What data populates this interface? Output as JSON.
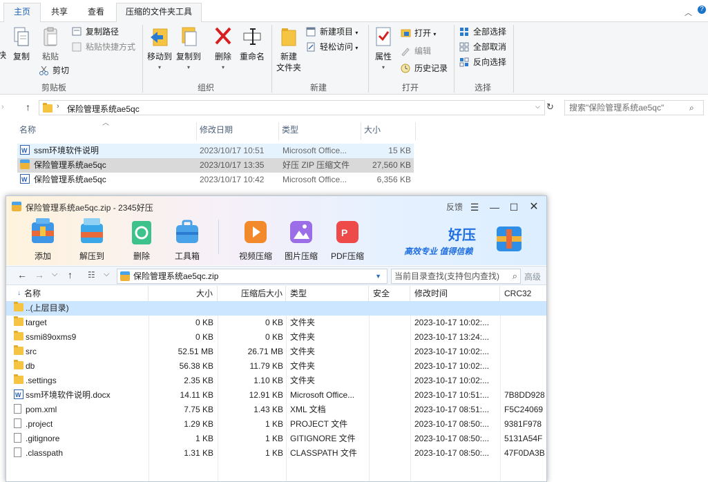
{
  "explorer": {
    "tabs": [
      "主页",
      "共享",
      "查看",
      "压缩的文件夹工具"
    ],
    "ribbon": {
      "clipboard": {
        "label": "剪贴板",
        "cut_partial": "快",
        "copy": "复制",
        "paste": "粘贴",
        "copy_path": "复制路径",
        "paste_shortcut": "粘贴快捷方式",
        "cut": "剪切"
      },
      "organize": {
        "label": "组织",
        "move_to": "移动到",
        "copy_to": "复制到",
        "delete": "删除",
        "rename": "重命名"
      },
      "new": {
        "label": "新建",
        "new_folder_l1": "新建",
        "new_folder_l2": "文件夹",
        "new_item": "新建项目",
        "easy_access": "轻松访问"
      },
      "open": {
        "label": "打开",
        "properties": "属性",
        "open": "打开",
        "edit": "编辑",
        "history": "历史记录"
      },
      "select": {
        "label": "选择",
        "select_all": "全部选择",
        "select_none": "全部取消",
        "invert": "反向选择"
      }
    },
    "address": {
      "path": "保险管理系统ae5qc",
      "search_placeholder": "搜索\"保险管理系统ae5qc\""
    },
    "columns": [
      "名称",
      "修改日期",
      "类型",
      "大小"
    ],
    "files": [
      {
        "name": "ssm环境软件说明",
        "date": "2023/10/17 10:51",
        "type": "Microsoft Office...",
        "size": "15 KB",
        "icon": "word-doc-icon"
      },
      {
        "name": "保险管理系统ae5qc",
        "date": "2023/10/17 13:35",
        "type": "好压 ZIP 压缩文件",
        "size": "27,560 KB",
        "icon": "zip-archive-icon"
      },
      {
        "name": "保险管理系统ae5qc",
        "date": "2023/10/17 10:42",
        "type": "Microsoft Office...",
        "size": "6,356 KB",
        "icon": "word-doc-icon"
      }
    ]
  },
  "haozip": {
    "title": "保险管理系统ae5qc.zip - 2345好压",
    "feedback": "反馈",
    "toolbar": [
      {
        "label": "添加",
        "icon": "add-archive-icon"
      },
      {
        "label": "解压到",
        "icon": "extract-icon"
      },
      {
        "label": "删除",
        "icon": "recycle-delete-icon"
      },
      {
        "label": "工具箱",
        "icon": "toolbox-icon"
      },
      {
        "label": "视频压缩",
        "icon": "video-compress-icon"
      },
      {
        "label": "图片压缩",
        "icon": "image-compress-icon"
      },
      {
        "label": "PDF压缩",
        "icon": "pdf-compress-icon"
      }
    ],
    "brand": {
      "name": "好压",
      "slogan": "高效专业 值得信赖"
    },
    "path": "保险管理系统ae5qc.zip",
    "search_placeholder": "当前目录查找(支持包内查找)",
    "advanced": "高级",
    "columns": [
      "名称",
      "大小",
      "压缩后大小",
      "类型",
      "安全",
      "修改时间",
      "CRC32"
    ],
    "rows": [
      {
        "name": "..(上层目录)",
        "size": "",
        "packed": "",
        "type": "",
        "security": "",
        "modified": "",
        "crc": "",
        "icon": "folder-icon"
      },
      {
        "name": "target",
        "size": "0 KB",
        "packed": "0 KB",
        "type": "文件夹",
        "security": "",
        "modified": "2023-10-17 10:02:...",
        "crc": "",
        "icon": "folder-icon"
      },
      {
        "name": "ssmi89oxms9",
        "size": "0 KB",
        "packed": "0 KB",
        "type": "文件夹",
        "security": "",
        "modified": "2023-10-17 13:24:...",
        "crc": "",
        "icon": "folder-icon"
      },
      {
        "name": "src",
        "size": "52.51 MB",
        "packed": "26.71 MB",
        "type": "文件夹",
        "security": "",
        "modified": "2023-10-17 10:02:...",
        "crc": "",
        "icon": "folder-icon"
      },
      {
        "name": "db",
        "size": "56.38 KB",
        "packed": "11.79 KB",
        "type": "文件夹",
        "security": "",
        "modified": "2023-10-17 10:02:...",
        "crc": "",
        "icon": "folder-icon"
      },
      {
        "name": ".settings",
        "size": "2.35 KB",
        "packed": "1.10 KB",
        "type": "文件夹",
        "security": "",
        "modified": "2023-10-17 10:02:...",
        "crc": "",
        "icon": "folder-icon"
      },
      {
        "name": "ssm环境软件说明.docx",
        "size": "14.11 KB",
        "packed": "12.91 KB",
        "type": "Microsoft Office...",
        "security": "",
        "modified": "2023-10-17 10:51:...",
        "crc": "7B8DD928",
        "icon": "word-doc-icon"
      },
      {
        "name": "pom.xml",
        "size": "7.75 KB",
        "packed": "1.43 KB",
        "type": "XML 文档",
        "security": "",
        "modified": "2023-10-17 08:51:...",
        "crc": "F5C24069",
        "icon": "file-icon"
      },
      {
        "name": ".project",
        "size": "1.29 KB",
        "packed": "1 KB",
        "type": "PROJECT 文件",
        "security": "",
        "modified": "2023-10-17 08:50:...",
        "crc": "9381F978",
        "icon": "file-icon"
      },
      {
        "name": ".gitignore",
        "size": "1 KB",
        "packed": "1 KB",
        "type": "GITIGNORE 文件",
        "security": "",
        "modified": "2023-10-17 08:50:...",
        "crc": "5131A54F",
        "icon": "file-icon"
      },
      {
        "name": ".classpath",
        "size": "1.31 KB",
        "packed": "1 KB",
        "type": "CLASSPATH 文件",
        "security": "",
        "modified": "2023-10-17 08:50:...",
        "crc": "47F0DA3B",
        "icon": "file-icon"
      }
    ]
  }
}
